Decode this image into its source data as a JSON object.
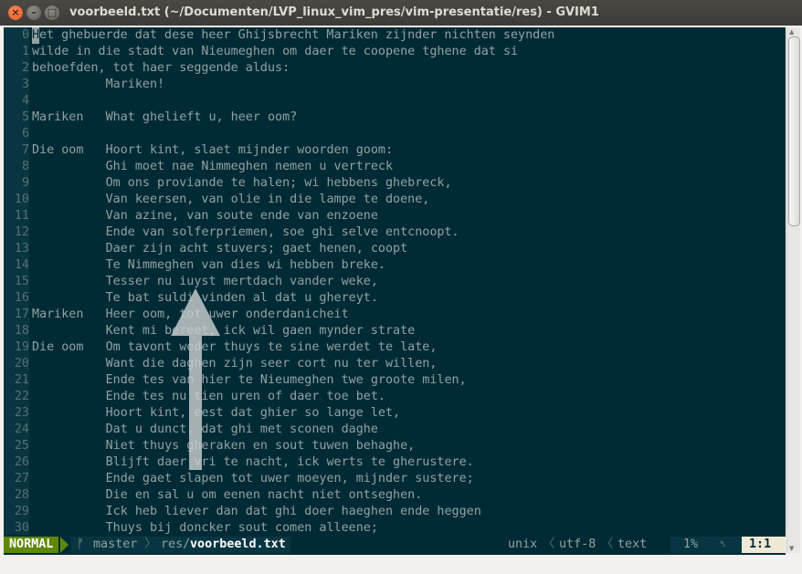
{
  "window": {
    "title": "voorbeeld.txt (~/Documenten/LVP_linux_vim_pres/vim-presentatie/res) - GVIM1",
    "close_glyph": "×",
    "minimize_glyph": "–",
    "maximize_glyph": "□"
  },
  "editor": {
    "cursor_char": "H",
    "first_line_rest": "et ghebuerde dat dese heer Ghijsbrecht Mariken zijnder nichten seynden",
    "lines": [
      {
        "num": "0",
        "text": ""
      },
      {
        "num": "1",
        "text": "wilde in die stadt van Nieumeghen om daer te coopene tghene dat si"
      },
      {
        "num": "2",
        "text": "behoefden, tot haer seggende aldus:"
      },
      {
        "num": "3",
        "text": "          Mariken!"
      },
      {
        "num": "4",
        "text": ""
      },
      {
        "num": "5",
        "text": "Mariken   What ghelieft u, heer oom?"
      },
      {
        "num": "6",
        "text": ""
      },
      {
        "num": "7",
        "text": "Die oom   Hoort kint, slaet mijnder woorden goom:"
      },
      {
        "num": "8",
        "text": "          Ghi moet nae Nimmeghen nemen u vertreck"
      },
      {
        "num": "9",
        "text": "          Om ons proviande te halen; wi hebbens ghebreck,"
      },
      {
        "num": "10",
        "text": "          Van keersen, van olie in die lampe te doene,"
      },
      {
        "num": "11",
        "text": "          Van azine, van soute ende van enzoene"
      },
      {
        "num": "12",
        "text": "          Ende van solferpriemen, soe ghi selve entcnoopt."
      },
      {
        "num": "13",
        "text": "          Daer zijn acht stuvers; gaet henen, coopt"
      },
      {
        "num": "14",
        "text": "          Te Nimmeghen van dies wi hebben breke."
      },
      {
        "num": "15",
        "text": "          Tesser nu iuyst mertdach vander weke,"
      },
      {
        "num": "16",
        "text": "          Te bat suldi vinden al dat u ghereyt."
      },
      {
        "num": "17",
        "text": "Mariken   Heer oom, tot uwer onderdanicheit"
      },
      {
        "num": "18",
        "text": "          Kent mi bereet, ick wil gaen mynder strate"
      },
      {
        "num": "19",
        "text": "Die oom   Om tavont weder thuys te sine werdet te late,"
      },
      {
        "num": "20",
        "text": "          Want die daghen zijn seer cort nu ter willen,"
      },
      {
        "num": "21",
        "text": "          Ende tes van hier te Nieumeghen twe groote milen,"
      },
      {
        "num": "22",
        "text": "          Ende tes nu tien uren of daer toe bet."
      },
      {
        "num": "23",
        "text": "          Hoort kint, eest dat ghier so lange let,"
      },
      {
        "num": "24",
        "text": "          Dat u dunct, dat ghi met sconen daghe"
      },
      {
        "num": "25",
        "text": "          Niet thuys gheraken en sout tuwen behaghe,"
      },
      {
        "num": "26",
        "text": "          Blijft daer vri te nacht, ick werts te gherustere."
      },
      {
        "num": "27",
        "text": "          Ende gaet slapen tot uwer moeyen, mijnder sustere;"
      },
      {
        "num": "28",
        "text": "          Die en sal u om eenen nacht niet ontseghen."
      },
      {
        "num": "29",
        "text": "          Ick heb liever dan dat ghi doer haeghen ende heggen"
      },
      {
        "num": "30",
        "text": "          Thuys bij doncker sout comen alleene;"
      }
    ]
  },
  "statusline": {
    "mode": "NORMAL",
    "branch_icon": "ᚠ",
    "branch": "master",
    "path_dir": "res/",
    "path_file": "voorbeeld.txt",
    "fileformat": "unix",
    "encoding": "utf-8",
    "filetype": "text",
    "percent": "1%",
    "ln_icon": "␤",
    "position": "1:1"
  },
  "colors": {
    "background": "#002b36",
    "foreground": "#93a1a1",
    "line_number": "#586e75",
    "mode_normal": "#5f8700",
    "overlay_arrow": "#c8d0d0"
  },
  "overlay": {
    "shape": "up-arrow"
  }
}
